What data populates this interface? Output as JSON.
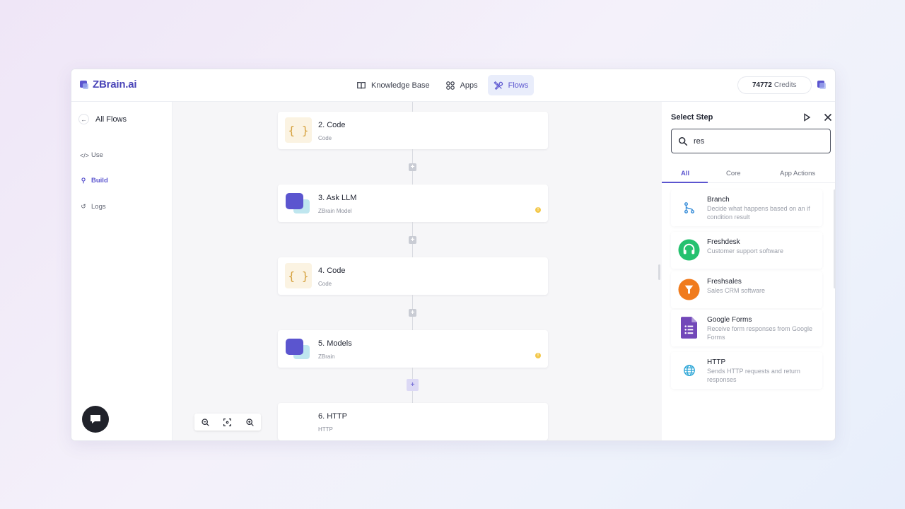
{
  "header": {
    "logo": "ZBrain.ai",
    "nav": [
      {
        "label": "Knowledge Base"
      },
      {
        "label": "Apps"
      },
      {
        "label": "Flows"
      }
    ],
    "credits_value": "74772",
    "credits_label": "Credits"
  },
  "sidebar": {
    "back_label": "All Flows",
    "items": [
      {
        "label": "Use",
        "icon": "code-icon"
      },
      {
        "label": "Build",
        "icon": "build-icon"
      },
      {
        "label": "Logs",
        "icon": "history-icon"
      }
    ]
  },
  "canvas": {
    "steps": [
      {
        "title": "2. Code",
        "subtitle": "Code",
        "icon": "code-braces-icon"
      },
      {
        "title": "3. Ask LLM",
        "subtitle": "ZBrain Model",
        "icon": "zbrain-icon"
      },
      {
        "title": "4. Code",
        "subtitle": "Code",
        "icon": "code-braces-icon"
      },
      {
        "title": "5. Models",
        "subtitle": "ZBrain",
        "icon": "zbrain-icon"
      },
      {
        "title": "6. HTTP",
        "subtitle": "HTTP",
        "icon": "none"
      }
    ],
    "code_glyph": "{ }",
    "plus_glyph": "+",
    "warn_glyph": "!"
  },
  "panel": {
    "title": "Select Step",
    "search_value": "res",
    "tabs": [
      {
        "label": "All"
      },
      {
        "label": "Core"
      },
      {
        "label": "App Actions"
      }
    ],
    "results": [
      {
        "name": "Branch",
        "description": "Decide what happens based on an if condition result",
        "icon": "branch-icon"
      },
      {
        "name": "Freshdesk",
        "description": "Customer support software",
        "icon": "headset-icon",
        "color": "#25c16f"
      },
      {
        "name": "Freshsales",
        "description": "Sales CRM software",
        "icon": "funnel-icon",
        "color": "#f07b1d"
      },
      {
        "name": "Google Forms",
        "description": "Receive form responses from Google Forms",
        "icon": "google-forms-icon",
        "color": "#7248b9"
      },
      {
        "name": "HTTP",
        "description": "Sends HTTP requests and return responses",
        "icon": "globe-icon",
        "color": "#2aa5d6"
      }
    ]
  },
  "colors": {
    "accent": "#5b55cf",
    "warning": "#f3c84b"
  }
}
